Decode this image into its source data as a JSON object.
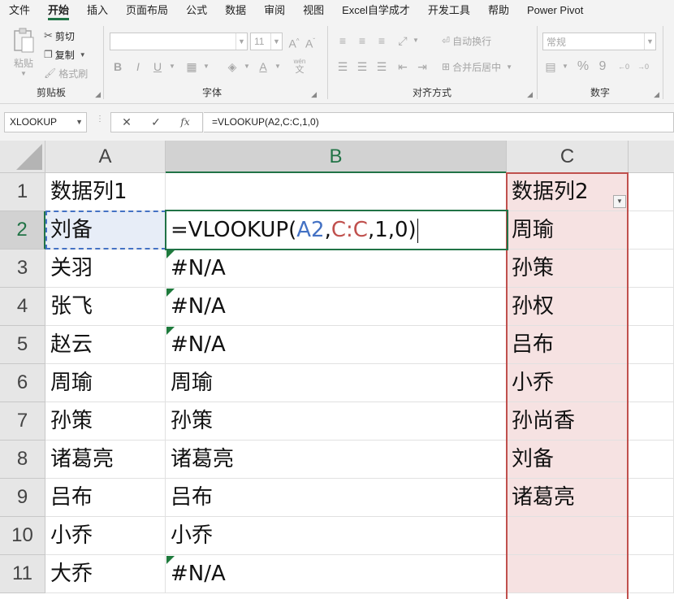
{
  "ribbon": {
    "tabs": [
      "文件",
      "开始",
      "插入",
      "页面布局",
      "公式",
      "数据",
      "审阅",
      "视图",
      "Excel自学成才",
      "开发工具",
      "帮助",
      "Power Pivot"
    ],
    "active_tab": "开始",
    "clipboard": {
      "paste": "粘贴",
      "cut": "剪切",
      "copy": "复制",
      "format_painter": "格式刷",
      "label": "剪贴板"
    },
    "font": {
      "size": "11",
      "bold": "B",
      "italic": "I",
      "underline": "U",
      "grow": "A^",
      "shrink": "Aˇ",
      "phonetic_top": "wén",
      "phonetic_bottom": "文",
      "font_color": "A",
      "label": "字体"
    },
    "alignment": {
      "wrap": "自动换行",
      "merge": "合并后居中",
      "label": "对齐方式"
    },
    "number": {
      "format": "常规",
      "percent": "%",
      "comma": "9",
      "label": "数字"
    }
  },
  "formula_bar": {
    "name_box": "XLOOKUP",
    "cancel": "✕",
    "enter": "✓",
    "fx": "fx",
    "formula": "=VLOOKUP(A2,C:C,1,0)"
  },
  "grid": {
    "columns": [
      "A",
      "B",
      "C"
    ],
    "rows": [
      "1",
      "2",
      "3",
      "4",
      "5",
      "6",
      "7",
      "8",
      "9",
      "10",
      "11"
    ],
    "col_a": [
      "数据列1",
      "刘备",
      "关羽",
      "张飞",
      "赵云",
      "周瑜",
      "孙策",
      "诸葛亮",
      "吕布",
      "小乔",
      "大乔"
    ],
    "col_b": [
      "",
      "",
      "#N/A",
      "#N/A",
      "#N/A",
      "周瑜",
      "孙策",
      "诸葛亮",
      "吕布",
      "小乔",
      "#N/A"
    ],
    "col_c": [
      "数据列2",
      "周瑜",
      "孙策",
      "孙权",
      "吕布",
      "小乔",
      "孙尚香",
      "刘备",
      "诸葛亮",
      "",
      ""
    ],
    "edit_cell": {
      "prefix": "=VLOOKUP(",
      "ref_a": "A2",
      "sep1": ",",
      "ref_c": "C:C",
      "suffix": ",1,0)"
    }
  },
  "colors": {
    "accent": "#217346",
    "ref_a": "#4472c4",
    "ref_c": "#c0504d",
    "error_triangle": "#1e7a3c",
    "highlight_col_c": "#f6e2e2"
  }
}
